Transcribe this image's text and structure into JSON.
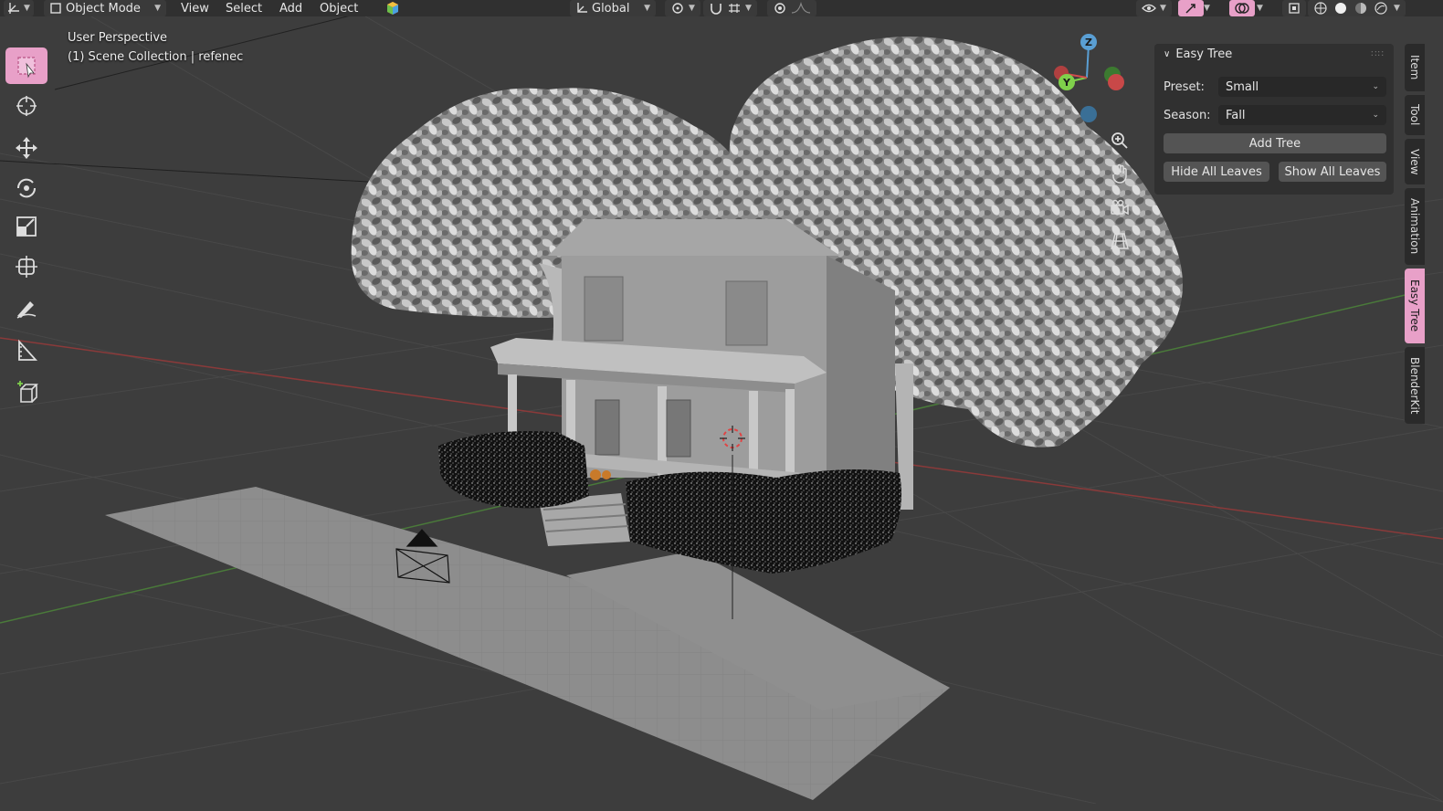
{
  "header": {
    "mode_label": "Object Mode",
    "menus": [
      "View",
      "Select",
      "Add",
      "Object"
    ],
    "transform_orientation": "Global"
  },
  "viewport": {
    "view_name": "User Perspective",
    "collection_info": "(1) Scene Collection | refenec",
    "gizmo_axes": {
      "x": "X",
      "y": "Y",
      "z": "Z"
    }
  },
  "toolbar": {
    "tools": [
      "select-box-icon",
      "cursor-icon",
      "move-icon",
      "rotate-icon",
      "scale-icon",
      "transform-icon",
      "annotate-icon",
      "measure-icon",
      "add-cube-icon"
    ]
  },
  "npanel": {
    "title": "Easy Tree",
    "preset_label": "Preset:",
    "preset_value": "Small",
    "season_label": "Season:",
    "season_value": "Fall",
    "add_tree": "Add Tree",
    "hide_leaves": "Hide All Leaves",
    "show_leaves": "Show All Leaves"
  },
  "tabs": [
    "Item",
    "Tool",
    "View",
    "Animation",
    "Easy Tree",
    "BlenderKit"
  ],
  "colors": {
    "accent": "#e8a0c8",
    "x_axis": "#d24c4c",
    "y_axis": "#7fd04b",
    "z_axis": "#5a9fd4"
  }
}
